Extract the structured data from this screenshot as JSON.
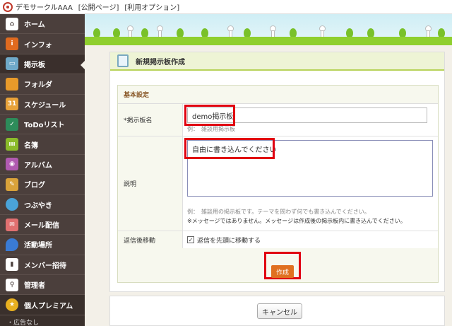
{
  "topbar": {
    "app_name": "デモサークルAAA",
    "public_page": "[公開ページ]",
    "options": "[利用オプション]"
  },
  "sidebar": {
    "items": [
      {
        "label": "ホーム",
        "icon": "home-icon",
        "color": "#ffffff"
      },
      {
        "label": "インフォ",
        "icon": "info-icon",
        "color": "#e06a1f"
      },
      {
        "label": "掲示板",
        "icon": "board-icon",
        "color": "#6fa9c9"
      },
      {
        "label": "フォルダ",
        "icon": "folder-icon",
        "color": "#e89a2a"
      },
      {
        "label": "スケジュール",
        "icon": "calendar-icon",
        "color": "#e8a23a"
      },
      {
        "label": "ToDoリスト",
        "icon": "todo-icon",
        "color": "#2d8c5a"
      },
      {
        "label": "名簿",
        "icon": "roster-icon",
        "color": "#8bbb2a"
      },
      {
        "label": "アルバム",
        "icon": "album-icon",
        "color": "#b05ab0"
      },
      {
        "label": "ブログ",
        "icon": "blog-icon",
        "color": "#d9a23a"
      },
      {
        "label": "つぶやき",
        "icon": "tweet-icon",
        "color": "#4aa3d8"
      },
      {
        "label": "メール配信",
        "icon": "mail-icon",
        "color": "#e07070"
      },
      {
        "label": "活動場所",
        "icon": "location-icon",
        "color": "#3a7bd5"
      },
      {
        "label": "メンバー招待",
        "icon": "invite-icon",
        "color": "#ffffff"
      },
      {
        "label": "管理者",
        "icon": "admin-icon",
        "color": "#ffffff"
      },
      {
        "label": "個人プレミアム",
        "icon": "premium-icon",
        "color": "#e8b020"
      }
    ],
    "sub_item": "・広告なし"
  },
  "form": {
    "title": "新規掲示板作成",
    "section_title": "基本設定",
    "name_label": "*掲示板名",
    "name_value": "demo掲示板",
    "name_hint": "例：　雑談用掲示板",
    "desc_label": "説明",
    "desc_value": "自由に書き込んでください",
    "desc_hint": "例：　雑談用の掲示板です。テーマを問わず何でも書き込んでください。",
    "desc_warning": "※メッセージではありません。メッセージは作成後の掲示板内に書き込んでください。",
    "reply_label": "返信後移動",
    "reply_checkbox_label": "返信を先頭に移動する",
    "submit_label": "作成",
    "cancel_label": "キャンセル"
  },
  "colors": {
    "sidebar_bg": "#4b3f3c",
    "accent_green": "#b8d35a",
    "highlight_red": "#e00010",
    "submit_orange": "#e07020"
  }
}
